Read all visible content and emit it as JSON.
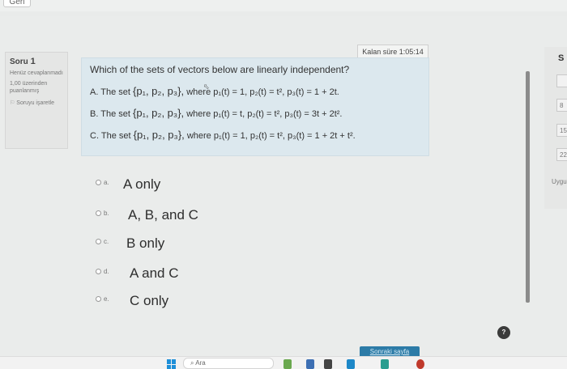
{
  "nav": {
    "back_label": "Geri"
  },
  "info": {
    "question_prefix": "Soru",
    "question_number": "1",
    "status": "Henüz cevaplanmadı",
    "points": "1,00 üzerinden puanlanmış",
    "flag_label": "Soruyu işaretle",
    "flag_icon": "flag-icon"
  },
  "timer": {
    "label": "Kalan süre 1:05:14"
  },
  "question": {
    "text": "Which of the sets of vectors below are linearly independent?",
    "options": [
      {
        "prefix": "A. The set",
        "set": "{p₁, p₂, p₃},",
        "where": "where",
        "p1": "p₁(t) = 1,",
        "p2": "p₂(t) = t²,",
        "p3": "p₃(t) = 1 + 2t."
      },
      {
        "prefix": "B. The set",
        "set": "{p₁, p₂, p₃},",
        "where": "where",
        "p1": "p₁(t) = t,",
        "p2": "p₂(t) = t²,",
        "p3": "p₃(t) = 3t + 2t²."
      },
      {
        "prefix": "C. The set",
        "set": "{p₁, p₂, p₃},",
        "where": "where",
        "p1": "p₁(t) = 1,",
        "p2": "p₂(t) = t²,",
        "p3": "p₃(t) = 1 + 2t + t²."
      }
    ]
  },
  "answers": [
    {
      "letter": "a.",
      "text": "A only"
    },
    {
      "letter": "b.",
      "text": "A, B, and C"
    },
    {
      "letter": "c.",
      "text": "B only"
    },
    {
      "letter": "d.",
      "text": "A and C"
    },
    {
      "letter": "e.",
      "text": "C only"
    }
  ],
  "right_panel": {
    "heading": "S",
    "boxes": [
      "",
      "8",
      "15",
      "22"
    ],
    "footer": "Uygu"
  },
  "help": {
    "label": "?"
  },
  "next": {
    "label": "Sonraki sayfa"
  },
  "taskbar": {
    "search_placeholder": "Ara"
  },
  "colors": {
    "accent": "#2c7ba7",
    "question_bg": "#dce8ee",
    "windows_blue": "#1e8fd8"
  }
}
